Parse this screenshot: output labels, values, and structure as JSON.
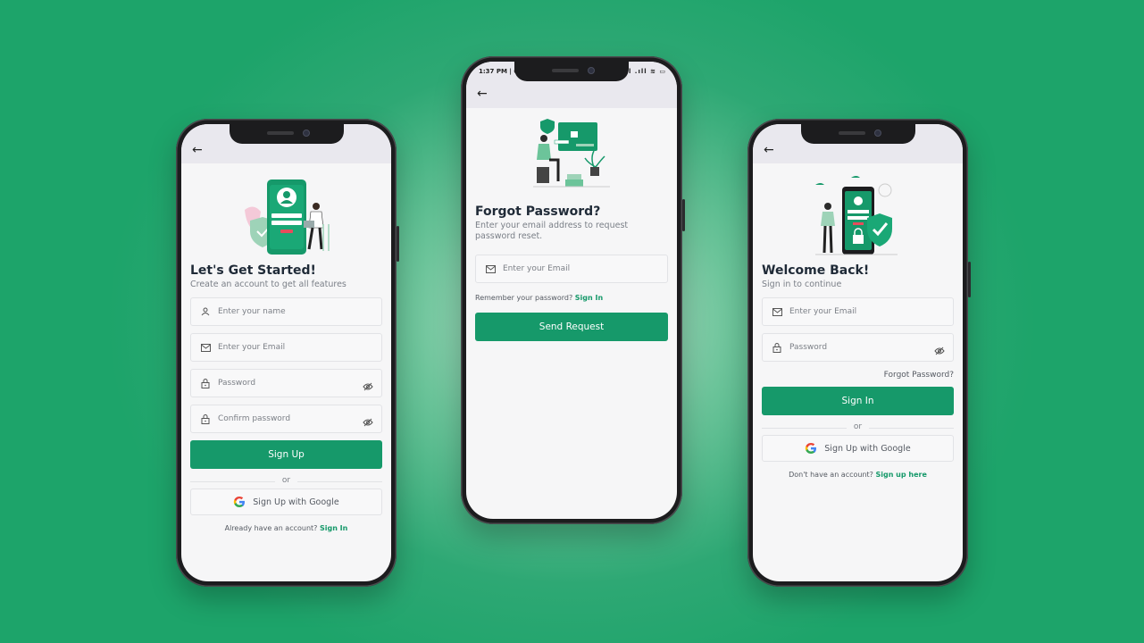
{
  "signup": {
    "title": "Let's Get Started!",
    "subtitle": "Create an account to get all features",
    "name_placeholder": "Enter your name",
    "email_placeholder": "Enter your Email",
    "password_placeholder": "Password",
    "confirm_placeholder": "Confirm password",
    "submit_label": "Sign Up",
    "or_label": "or",
    "google_label": "Sign Up with Google",
    "footer_text": "Already have an account?",
    "footer_link": "Sign In"
  },
  "forgot": {
    "status_time": "1:37 PM | 0.0KB/s",
    "status_icons": ".ıll .ıll ≋ ▭",
    "title": "Forgot Password?",
    "subtitle": "Enter your email address to request password reset.",
    "email_placeholder": "Enter your Email",
    "remember_text": "Remember your password?",
    "remember_link": "Sign In",
    "submit_label": "Send Request"
  },
  "signin": {
    "title": "Welcome Back!",
    "subtitle": "Sign in to continue",
    "email_placeholder": "Enter your Email",
    "password_placeholder": "Password",
    "forgot_label": "Forgot Password?",
    "submit_label": "Sign In",
    "or_label": "or",
    "google_label": "Sign Up with Google",
    "footer_text": "Don't have an account?",
    "footer_link": "Sign up here"
  },
  "icons": {
    "back": "←"
  },
  "colors": {
    "primary": "#16996a",
    "background": "#1da46a",
    "text_dark": "#1f2a37"
  }
}
